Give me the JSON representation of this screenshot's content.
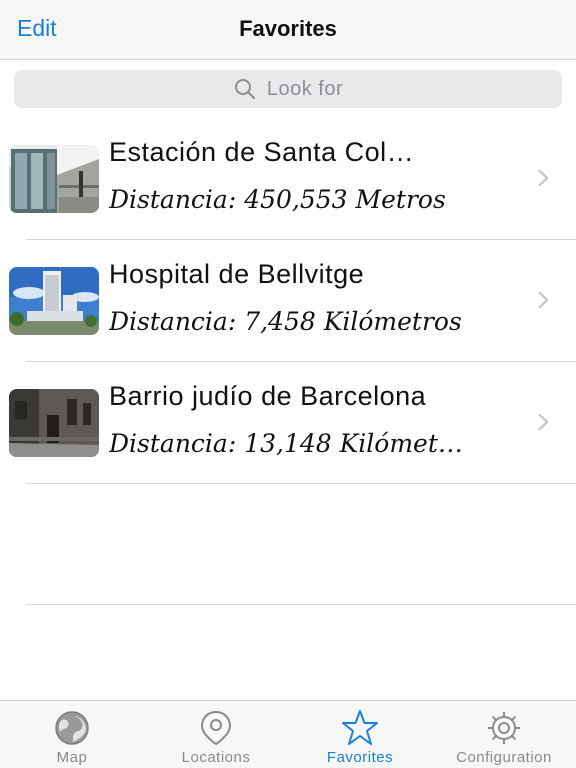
{
  "navbar": {
    "edit_label": "Edit",
    "title": "Favorites"
  },
  "search": {
    "placeholder": "Look for",
    "icon": "search-icon"
  },
  "favorites": [
    {
      "title": "Estación de Santa Col…",
      "distance": "Distancia: 450,553 Metros",
      "thumbnail": "station-photo"
    },
    {
      "title": "Hospital de Bellvitge",
      "distance": "Distancia: 7,458 Kilómetros",
      "thumbnail": "hospital-photo"
    },
    {
      "title": "Barrio judío de Barcelona",
      "distance": "Distancia: 13,148 Kilómet…",
      "thumbnail": "street-photo"
    }
  ],
  "tabs": [
    {
      "label": "Map",
      "icon": "globe-icon",
      "active": false
    },
    {
      "label": "Locations",
      "icon": "location-pin-icon",
      "active": false
    },
    {
      "label": "Favorites",
      "icon": "star-icon",
      "active": true
    },
    {
      "label": "Configuration",
      "icon": "gear-icon",
      "active": false
    }
  ],
  "colors": {
    "accent": "#1c7ed6",
    "inactive": "#8a8a8a",
    "bar_background": "#f7f7f7"
  }
}
